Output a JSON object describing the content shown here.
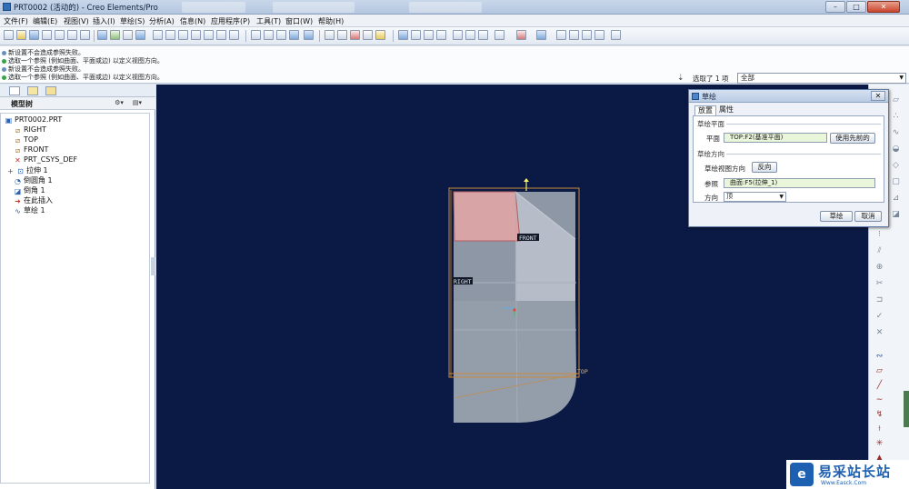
{
  "window": {
    "title": "PRT0002 (活动的) - Creo Elements/Pro",
    "controls": {
      "minimize": "–",
      "maximize": "□",
      "close": "✕"
    }
  },
  "menu": [
    "文件(F)",
    "编辑(E)",
    "视图(V)",
    "插入(I)",
    "草绘(S)",
    "分析(A)",
    "信息(N)",
    "应用程序(P)",
    "工具(T)",
    "窗口(W)",
    "帮助(H)"
  ],
  "messages": [
    "新设置不会造成参照失败。",
    "选取一个参照 (例如曲面、平面或边) 以定义视图方向。",
    "新设置不会造成参照失败。",
    "选取一个参照 (例如曲面、平面或边) 以定义视图方向。"
  ],
  "filter": {
    "selected_label": "选取了 1 项",
    "value": "全部"
  },
  "model_tree": {
    "header": "模型树",
    "items": [
      {
        "label": "PRT0002.PRT",
        "icon": "part-icon"
      },
      {
        "label": "RIGHT",
        "icon": "datum-plane-icon"
      },
      {
        "label": "TOP",
        "icon": "datum-plane-icon"
      },
      {
        "label": "FRONT",
        "icon": "datum-plane-icon"
      },
      {
        "label": "PRT_CSYS_DEF",
        "icon": "csys-icon"
      },
      {
        "label": "拉伸 1",
        "icon": "extrude-icon"
      },
      {
        "label": "倒圆角 1",
        "icon": "round-icon"
      },
      {
        "label": "倒角 1",
        "icon": "chamfer-icon"
      },
      {
        "label": "在此插入",
        "icon": "insert-here-arrow-icon"
      },
      {
        "label": "草绘 1",
        "icon": "sketch-icon"
      }
    ]
  },
  "canvas": {
    "labels": {
      "front": "FRONT",
      "right": "RIGHT",
      "top": "TOP"
    },
    "colors": {
      "background": "#0b1a45",
      "part": "#8e97a6",
      "sketch_plane": "#d9a4a6",
      "datum": "#c98a3a"
    }
  },
  "sketch_dialog": {
    "title": "草绘",
    "tabs": [
      "放置",
      "属性"
    ],
    "plane_group": "草绘平面",
    "plane_label": "平面",
    "plane_value": "TOP:F2(基准平面)",
    "use_previous": "使用先前的",
    "direction_group": "草绘方向",
    "view_direction_label": "草绘视图方向",
    "flip_button": "反向",
    "reference_label": "参照",
    "reference_value": "曲面:F5(拉伸_1)",
    "orientation_label": "方向",
    "orientation_value": "顶",
    "ok_button": "草绘",
    "cancel_button": "取消"
  },
  "watermark": {
    "title": "易采站长站",
    "url": "Www.Easck.Com"
  }
}
